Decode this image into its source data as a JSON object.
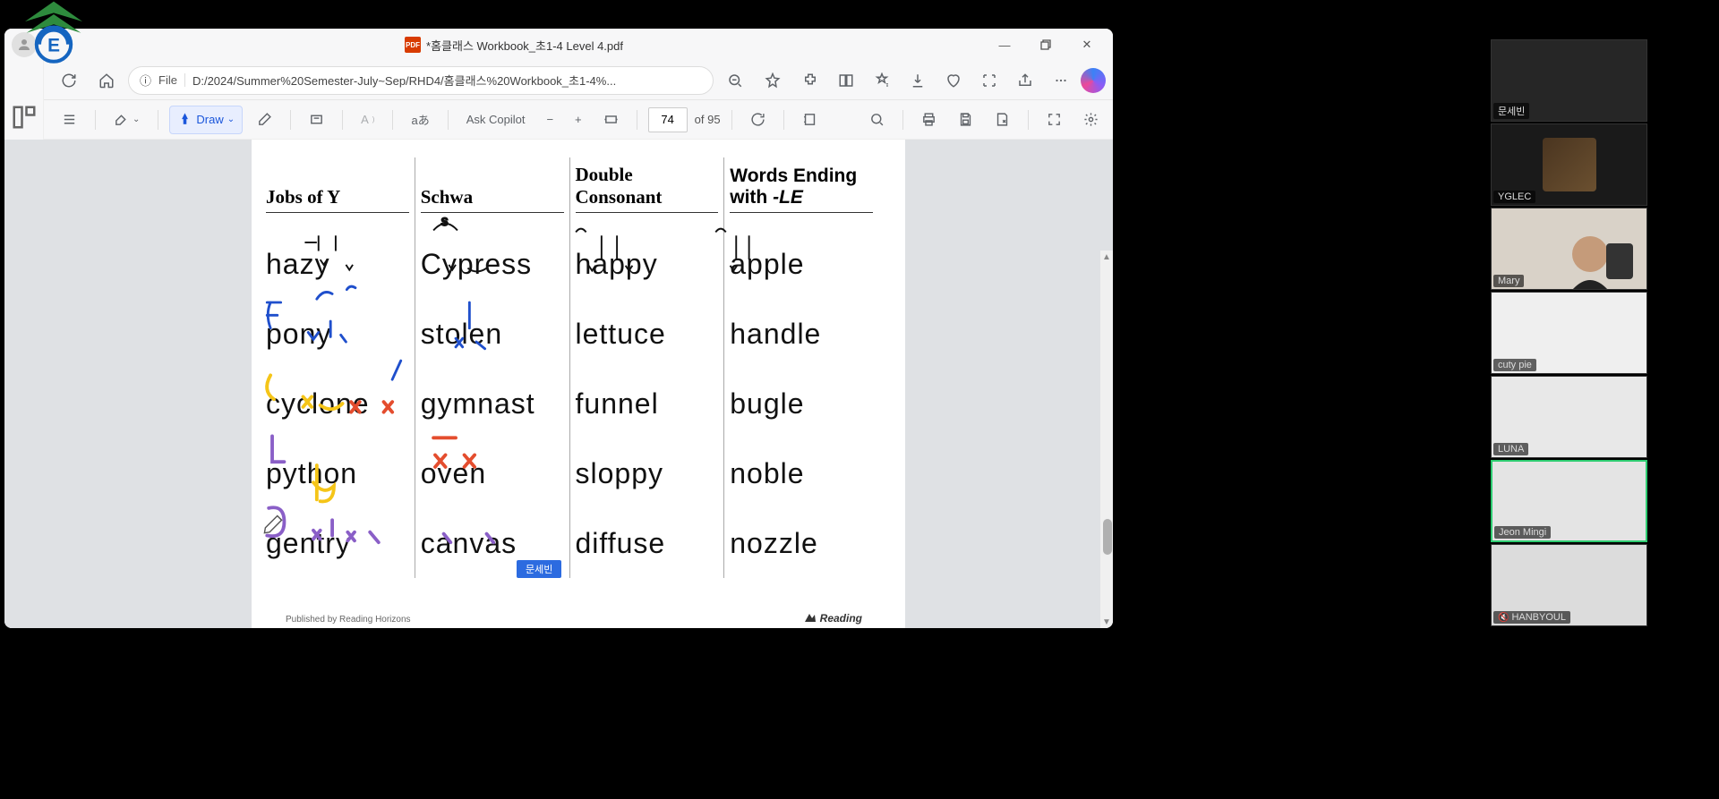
{
  "window": {
    "title_prefix": "*",
    "title": "홈클래스 Workbook_초1-4 Level 4.pdf"
  },
  "address": {
    "scheme_label": "File",
    "info_icon": "ⓘ",
    "path": "D:/2024/Summer%20Semester-July~Sep/RHD4/홈클래스%20Workbook_초1-4%..."
  },
  "pdf_toolbar": {
    "draw_label": "Draw",
    "ask_copilot": "Ask Copilot",
    "page_current": "74",
    "page_total": "of 95",
    "translate_glyph": "aあ"
  },
  "workbook": {
    "columns": [
      {
        "header": "Jobs of Y",
        "words": [
          "hazy",
          "pony",
          "cyclone",
          "python",
          "gentry"
        ]
      },
      {
        "header": "Schwa",
        "words": [
          "Cypress",
          "stolen",
          "gymnast",
          "oven",
          "canvas"
        ]
      },
      {
        "header": "Double Consonant",
        "words": [
          "happy",
          "lettuce",
          "funnel",
          "sloppy",
          "diffuse"
        ]
      },
      {
        "header": "Words Ending with -LE",
        "words": [
          "apple",
          "handle",
          "bugle",
          "noble",
          "nozzle"
        ]
      }
    ],
    "publisher": "Published by Reading Horizons",
    "brand": "Reading"
  },
  "annotation": {
    "user_tag": "문세빈"
  },
  "zoom_participants": [
    {
      "name": "문세빈",
      "muted": false,
      "camera": "off",
      "active": false
    },
    {
      "name": "YGLEC",
      "muted": false,
      "camera": "thumbnail",
      "active": false
    },
    {
      "name": "Mary",
      "muted": false,
      "camera": "on",
      "active": false
    },
    {
      "name": "cuty pie",
      "muted": false,
      "camera": "off",
      "active": false
    },
    {
      "name": "LUNA",
      "muted": false,
      "camera": "off",
      "active": false
    },
    {
      "name": "Jeon Mingi",
      "muted": false,
      "camera": "off",
      "active": true
    },
    {
      "name": "HANBYOUL",
      "muted": true,
      "camera": "off",
      "active": false
    }
  ],
  "colors": {
    "accent_blue": "#2c6be0",
    "ink_blue": "#1f4fcc",
    "ink_yellow": "#f5c518",
    "ink_red": "#e44d2e",
    "ink_purple": "#8a5fc7"
  }
}
